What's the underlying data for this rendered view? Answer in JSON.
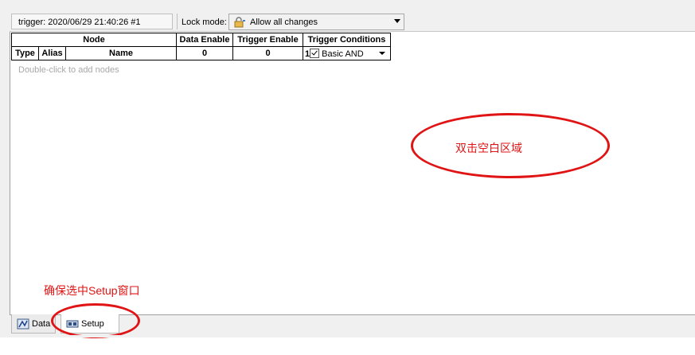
{
  "header": {
    "trigger_info": "trigger: 2020/06/29 21:40:26  #1",
    "lock_mode_label": "Lock mode:",
    "lock_mode_value": "Allow all changes"
  },
  "table": {
    "group_header": "Node",
    "columns": {
      "data_enable": "Data Enable",
      "trigger_enable": "Trigger Enable",
      "trigger_conditions": "Trigger Conditions"
    },
    "subcolumns": {
      "type": "Type",
      "alias": "Alias",
      "name": "Name"
    },
    "summary_row": {
      "data_enable_count": "0",
      "trigger_enable_count": "0",
      "condition_index": "1",
      "condition_value": "Basic AND"
    },
    "empty_hint": "Double-click to add nodes"
  },
  "annotations": {
    "double_click_note": "双击空白区域",
    "setup_note": "确保选中Setup窗口"
  },
  "tabs": [
    {
      "label": "Data",
      "icon": "data-icon"
    },
    {
      "label": "Setup",
      "icon": "setup-icon"
    }
  ],
  "colors": {
    "annotation": "#e01414"
  }
}
